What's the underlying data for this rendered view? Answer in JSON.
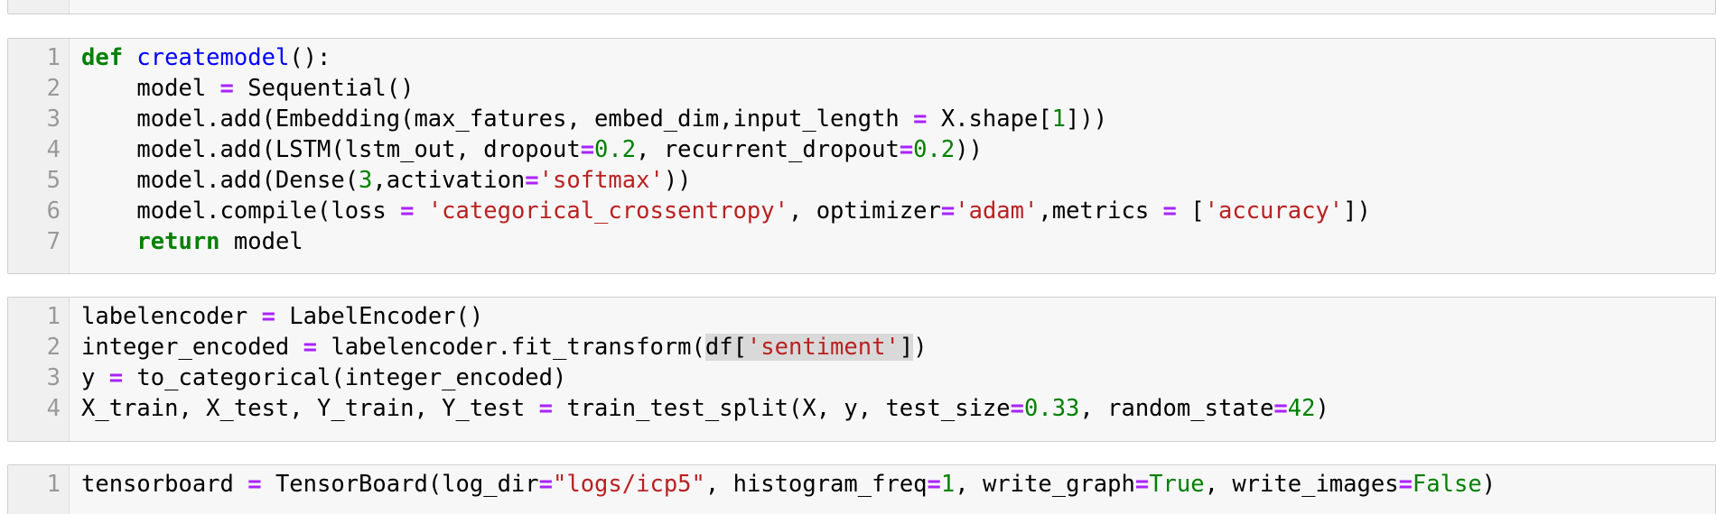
{
  "cells": [
    {
      "id": "cell-createmodel",
      "lines": [
        {
          "n": "1",
          "tokens": [
            [
              "kw",
              "def"
            ],
            [
              "t",
              " "
            ],
            [
              "def",
              "createmodel"
            ],
            [
              "t",
              "():"
            ]
          ]
        },
        {
          "n": "2",
          "tokens": [
            [
              "t",
              "    model "
            ],
            [
              "op",
              "="
            ],
            [
              "t",
              " Sequential()"
            ]
          ]
        },
        {
          "n": "3",
          "tokens": [
            [
              "t",
              "    model.add(Embedding(max_fatures, embed_dim,input_length "
            ],
            [
              "op",
              "="
            ],
            [
              "t",
              " X.shape["
            ],
            [
              "num",
              "1"
            ],
            [
              "t",
              "]))"
            ]
          ]
        },
        {
          "n": "4",
          "tokens": [
            [
              "t",
              "    model.add(LSTM(lstm_out, dropout"
            ],
            [
              "op",
              "="
            ],
            [
              "num",
              "0.2"
            ],
            [
              "t",
              ", recurrent_dropout"
            ],
            [
              "op",
              "="
            ],
            [
              "num",
              "0.2"
            ],
            [
              "t",
              "))"
            ]
          ]
        },
        {
          "n": "5",
          "tokens": [
            [
              "t",
              "    model.add(Dense("
            ],
            [
              "num",
              "3"
            ],
            [
              "t",
              ",activation"
            ],
            [
              "op",
              "="
            ],
            [
              "str",
              "'softmax'"
            ],
            [
              "t",
              "))"
            ]
          ]
        },
        {
          "n": "6",
          "tokens": [
            [
              "t",
              "    model.compile(loss "
            ],
            [
              "op",
              "="
            ],
            [
              "t",
              " "
            ],
            [
              "str",
              "'categorical_crossentropy'"
            ],
            [
              "t",
              ", optimizer"
            ],
            [
              "op",
              "="
            ],
            [
              "str",
              "'adam'"
            ],
            [
              "t",
              ",metrics "
            ],
            [
              "op",
              "="
            ],
            [
              "t",
              " ["
            ],
            [
              "str",
              "'accuracy'"
            ],
            [
              "t",
              "])"
            ]
          ]
        },
        {
          "n": "7",
          "tokens": [
            [
              "t",
              "    "
            ],
            [
              "kw",
              "return"
            ],
            [
              "t",
              " model"
            ]
          ]
        }
      ]
    },
    {
      "id": "cell-encoding",
      "lines": [
        {
          "n": "1",
          "tokens": [
            [
              "t",
              "labelencoder "
            ],
            [
              "op",
              "="
            ],
            [
              "t",
              " LabelEncoder()"
            ]
          ]
        },
        {
          "n": "2",
          "tokens": [
            [
              "t",
              "integer_encoded "
            ],
            [
              "op",
              "="
            ],
            [
              "t",
              " labelencoder.fit_transform("
            ],
            [
              "hl",
              "df["
            ],
            [
              "hlstr",
              "'sentiment'"
            ],
            [
              "hl",
              "]"
            ],
            [
              "t",
              ")"
            ]
          ]
        },
        {
          "n": "3",
          "tokens": [
            [
              "t",
              "y "
            ],
            [
              "op",
              "="
            ],
            [
              "t",
              " to_categorical(integer_encoded)"
            ]
          ]
        },
        {
          "n": "4",
          "tokens": [
            [
              "t",
              "X_train, X_test, Y_train, Y_test "
            ],
            [
              "op",
              "="
            ],
            [
              "t",
              " train_test_split(X, y, test_size"
            ],
            [
              "op",
              "="
            ],
            [
              "num",
              "0.33"
            ],
            [
              "t",
              ", random_state"
            ],
            [
              "op",
              "="
            ],
            [
              "num",
              "42"
            ],
            [
              "t",
              ")"
            ]
          ]
        }
      ]
    },
    {
      "id": "cell-tensorboard",
      "lines": [
        {
          "n": "1",
          "tokens": [
            [
              "t",
              "tensorboard "
            ],
            [
              "op",
              "="
            ],
            [
              "t",
              " TensorBoard(log_dir"
            ],
            [
              "op",
              "="
            ],
            [
              "str",
              "\"logs/icp5\""
            ],
            [
              "t",
              ", histogram_freq"
            ],
            [
              "op",
              "="
            ],
            [
              "num",
              "1"
            ],
            [
              "t",
              ", write_graph"
            ],
            [
              "op",
              "="
            ],
            [
              "num",
              "True"
            ],
            [
              "t",
              ", write_images"
            ],
            [
              "op",
              "="
            ],
            [
              "num",
              "False"
            ],
            [
              "t",
              ")"
            ]
          ]
        }
      ]
    }
  ]
}
